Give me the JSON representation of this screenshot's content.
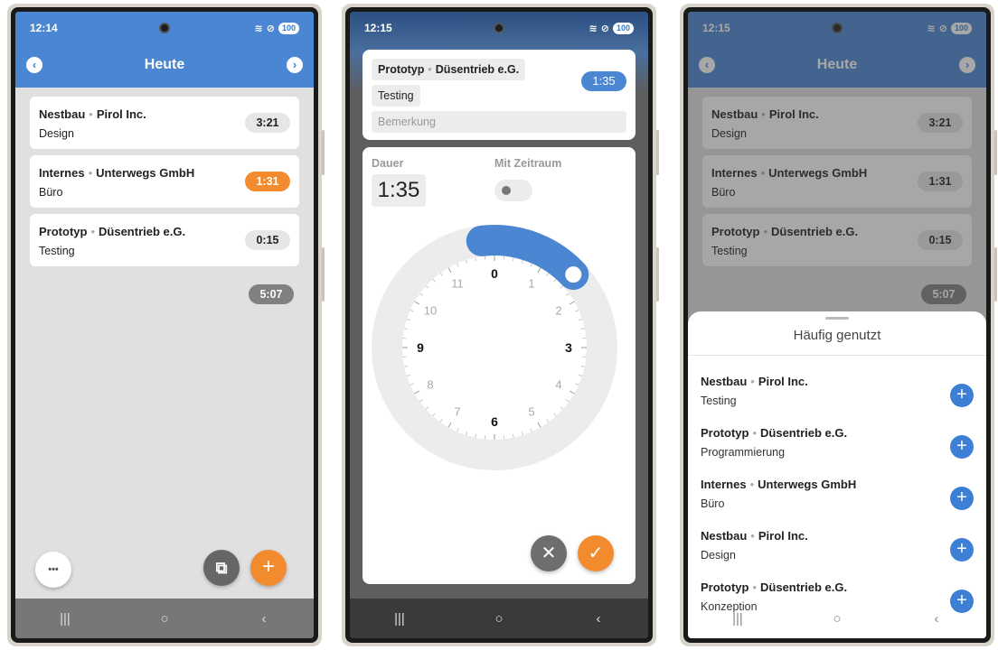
{
  "colors": {
    "accent_blue": "#4a86d1",
    "accent_orange": "#f28a2e",
    "add_blue": "#3d7fd4",
    "confirm_orange": "#f28a2e",
    "cancel_gray": "#6e6e6e"
  },
  "phone1": {
    "time": "12:14",
    "battery": "100",
    "title": "Heute",
    "prev_icon": "chevron-left-icon",
    "next_icon": "chevron-right-icon",
    "entries": [
      {
        "project": "Nestbau",
        "client": "Pirol Inc.",
        "task": "Design",
        "duration": "3:21",
        "active": false
      },
      {
        "project": "Internes",
        "client": "Unterwegs GmbH",
        "task": "Büro",
        "duration": "1:31",
        "active": true
      },
      {
        "project": "Prototyp",
        "client": "Düsentrieb e.G.",
        "task": "Testing",
        "duration": "0:15",
        "active": false
      }
    ],
    "total": "5:07",
    "more_label": "•••",
    "add_label": "+"
  },
  "phone2": {
    "time": "12:15",
    "battery": "100",
    "project": "Prototyp",
    "client": "Düsentrieb e.G.",
    "task": "Testing",
    "duration_badge": "1:35",
    "remark_placeholder": "Bemerkung",
    "dauer_label": "Dauer",
    "dauer_value": "1:35",
    "zeitraum_label": "Mit Zeitraum",
    "zeitraum_enabled": false,
    "dial_numbers": [
      "0",
      "1",
      "2",
      "3",
      "4",
      "5",
      "6",
      "7",
      "8",
      "9",
      "10",
      "11"
    ],
    "dial_fraction": 0.131,
    "cancel_label": "✕",
    "confirm_label": "✓"
  },
  "phone3": {
    "time": "12:15",
    "battery": "100",
    "title": "Heute",
    "entries": [
      {
        "project": "Nestbau",
        "client": "Pirol Inc.",
        "task": "Design",
        "duration": "3:21"
      },
      {
        "project": "Internes",
        "client": "Unterwegs GmbH",
        "task": "Büro",
        "duration": "1:31"
      },
      {
        "project": "Prototyp",
        "client": "Düsentrieb e.G.",
        "task": "Testing",
        "duration": "0:15"
      }
    ],
    "total": "5:07",
    "sheet_title": "Häufig genutzt",
    "frequent": [
      {
        "project": "Nestbau",
        "client": "Pirol Inc.",
        "task": "Testing"
      },
      {
        "project": "Prototyp",
        "client": "Düsentrieb e.G.",
        "task": "Programmierung"
      },
      {
        "project": "Internes",
        "client": "Unterwegs GmbH",
        "task": "Büro"
      },
      {
        "project": "Nestbau",
        "client": "Pirol Inc.",
        "task": "Design"
      },
      {
        "project": "Prototyp",
        "client": "Düsentrieb e.G.",
        "task": "Konzeption"
      }
    ]
  },
  "navbar": {
    "recents": "|||",
    "home": "○",
    "back": "‹"
  }
}
